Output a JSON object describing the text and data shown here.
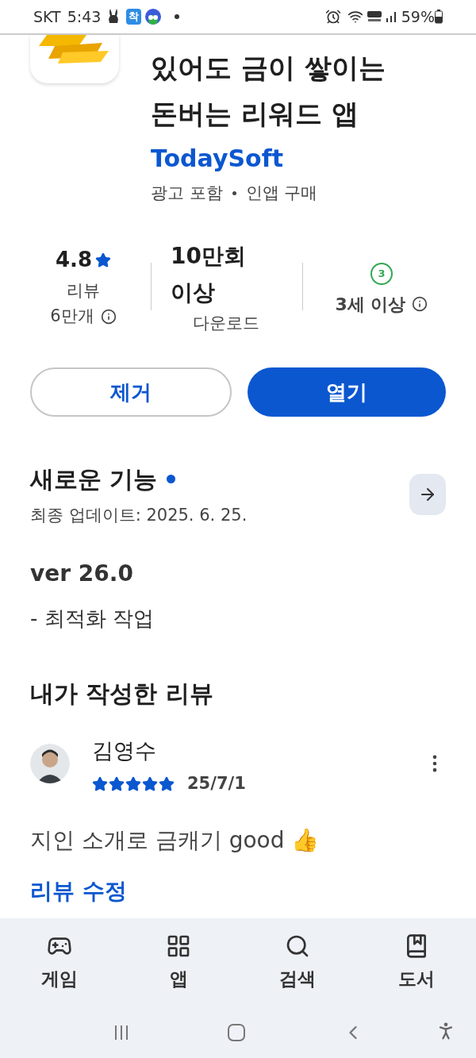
{
  "status_bar": {
    "carrier": "SKT",
    "time": "5:43",
    "notification_badge": "착",
    "battery": "59%"
  },
  "app": {
    "title_lines": [
      "있어도 금이 쌓이는",
      "돈버는 리워드 앱"
    ],
    "developer": "TodaySoft",
    "meta": [
      "광고 포함",
      "인앱 구매"
    ]
  },
  "stats": [
    {
      "kind": "rating",
      "value": "4.8",
      "label_lines": [
        "리뷰",
        "6만개"
      ]
    },
    {
      "kind": "downloads",
      "value_lines": [
        "10만회",
        "이상"
      ],
      "label": "다운로드"
    },
    {
      "kind": "age",
      "badge": "3",
      "label": "3세 이상"
    }
  ],
  "buttons": [
    {
      "label": "제거",
      "kind": "outline"
    },
    {
      "label": "열기",
      "kind": "filled"
    }
  ],
  "whats_new": {
    "title": "새로운 기능",
    "updated": "최종 업데이트: 2025. 6. 25.",
    "version": "ver 26.0",
    "notes": "- 최적화 작업"
  },
  "my_review": {
    "heading": "내가 작성한 리뷰",
    "author": "김영수",
    "stars": 5,
    "date": "25/7/1",
    "text": "지인 소개로 금캐기 good 👍",
    "edit_link": "리뷰 수정"
  },
  "bottom_nav": [
    {
      "label": "게임",
      "kind": "games",
      "selected": false
    },
    {
      "label": "앱",
      "kind": "apps",
      "selected": false
    },
    {
      "label": "검색",
      "kind": "search",
      "selected": false
    },
    {
      "label": "도서",
      "kind": "books",
      "selected": false
    }
  ]
}
